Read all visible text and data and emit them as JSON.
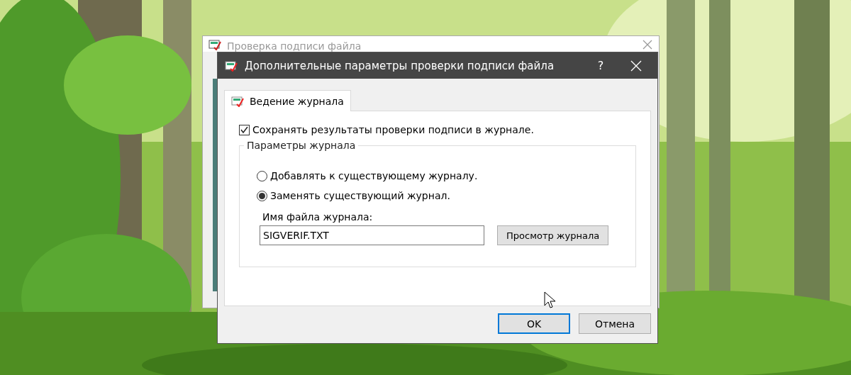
{
  "background_window": {
    "title": "Проверка подписи файла"
  },
  "dialog": {
    "title": "Дополнительные параметры проверки подписи файла",
    "help": "?"
  },
  "tabs": [
    {
      "label": "Ведение журнала",
      "selected": true
    }
  ],
  "save_log": {
    "label": "Сохранять результаты проверки подписи в журнале.",
    "checked": true
  },
  "log_options": {
    "title": "Параметры журнала",
    "modes": [
      {
        "label": "Добавлять к существующему журналу.",
        "selected": false
      },
      {
        "label": "Заменять существующий журнал.",
        "selected": true
      }
    ],
    "filename_label": "Имя файла журнала:",
    "filename": {
      "value": "SIGVERIF.TXT"
    },
    "view_button": "Просмотр журнала"
  },
  "buttons": [
    {
      "label": "OK",
      "default": true
    },
    {
      "label": "Отмена",
      "default": false
    }
  ]
}
